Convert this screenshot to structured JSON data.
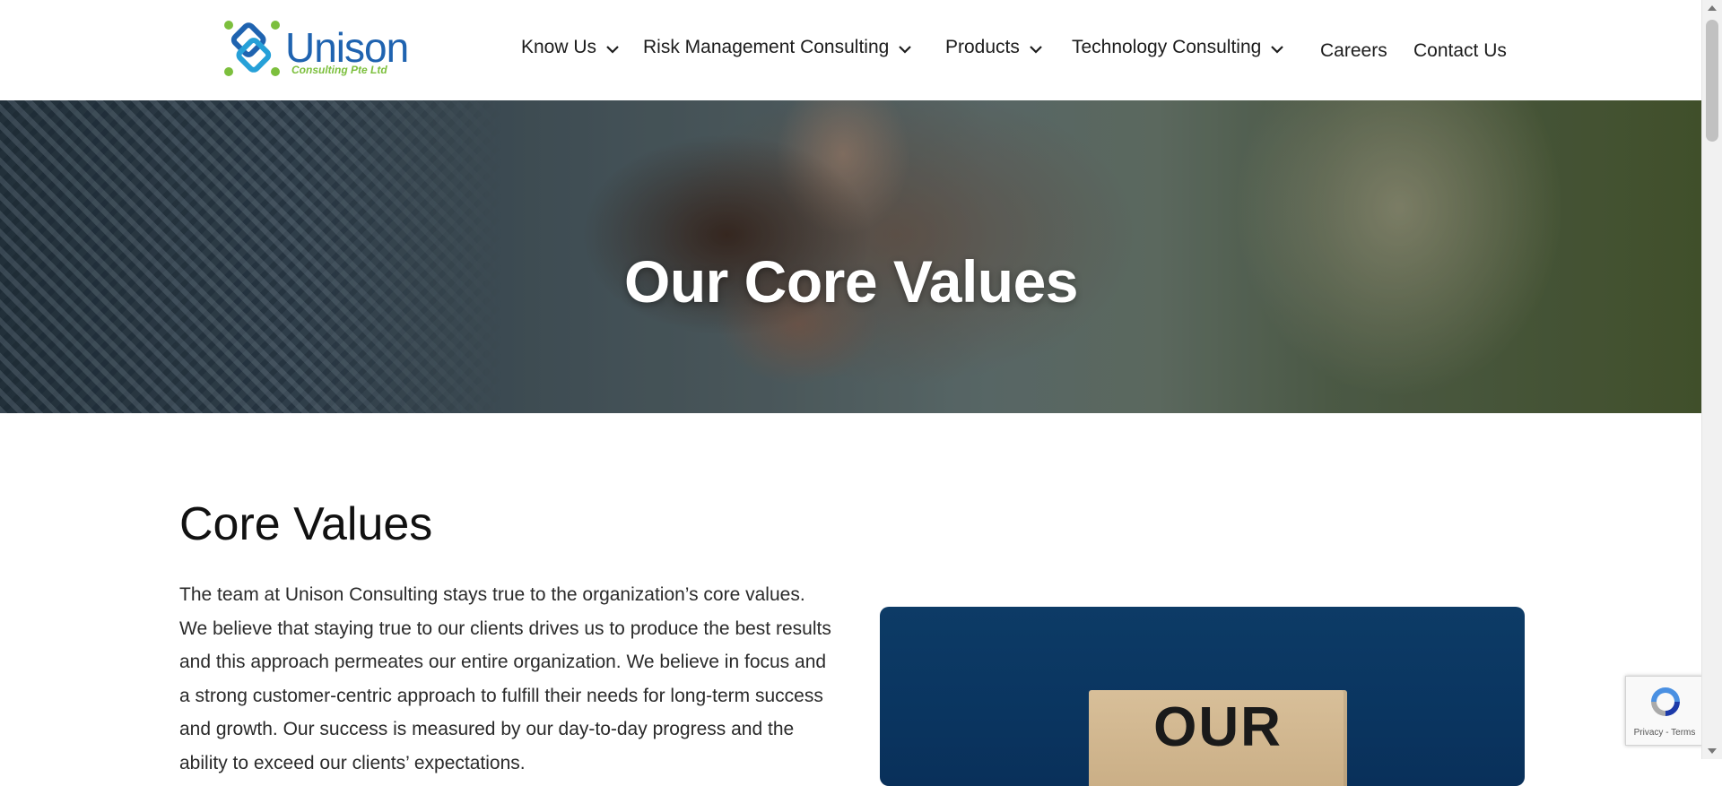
{
  "brand": {
    "name": "Unison",
    "subtitle": "Consulting Pte Ltd",
    "primary_color": "#1f63b0",
    "accent_color": "#7cbf3d"
  },
  "nav": {
    "items": [
      {
        "label": "Know Us",
        "has_dropdown": true
      },
      {
        "label": "Risk Management Consulting",
        "has_dropdown": true
      },
      {
        "label": "Products",
        "has_dropdown": true
      },
      {
        "label": "Technology Consulting",
        "has_dropdown": true
      },
      {
        "label": "Careers",
        "has_dropdown": false
      },
      {
        "label": "Contact Us",
        "has_dropdown": false
      }
    ]
  },
  "hero": {
    "title": "Our Core Values"
  },
  "main": {
    "section_title": "Core Values",
    "paragraph": "The team at Unison Consulting stays true to the organization’s core values. We believe that staying true to our clients drives us to produce the best results and this approach permeates our entire organization. We believe in focus and a strong customer-centric approach to fulfill their needs for long-term success and growth. Our success is measured by our day-to-day progress and the ability to exceed our clients’ expectations.",
    "image_block_text": "OUR"
  },
  "recaptcha": {
    "terms": "Privacy - Terms"
  }
}
